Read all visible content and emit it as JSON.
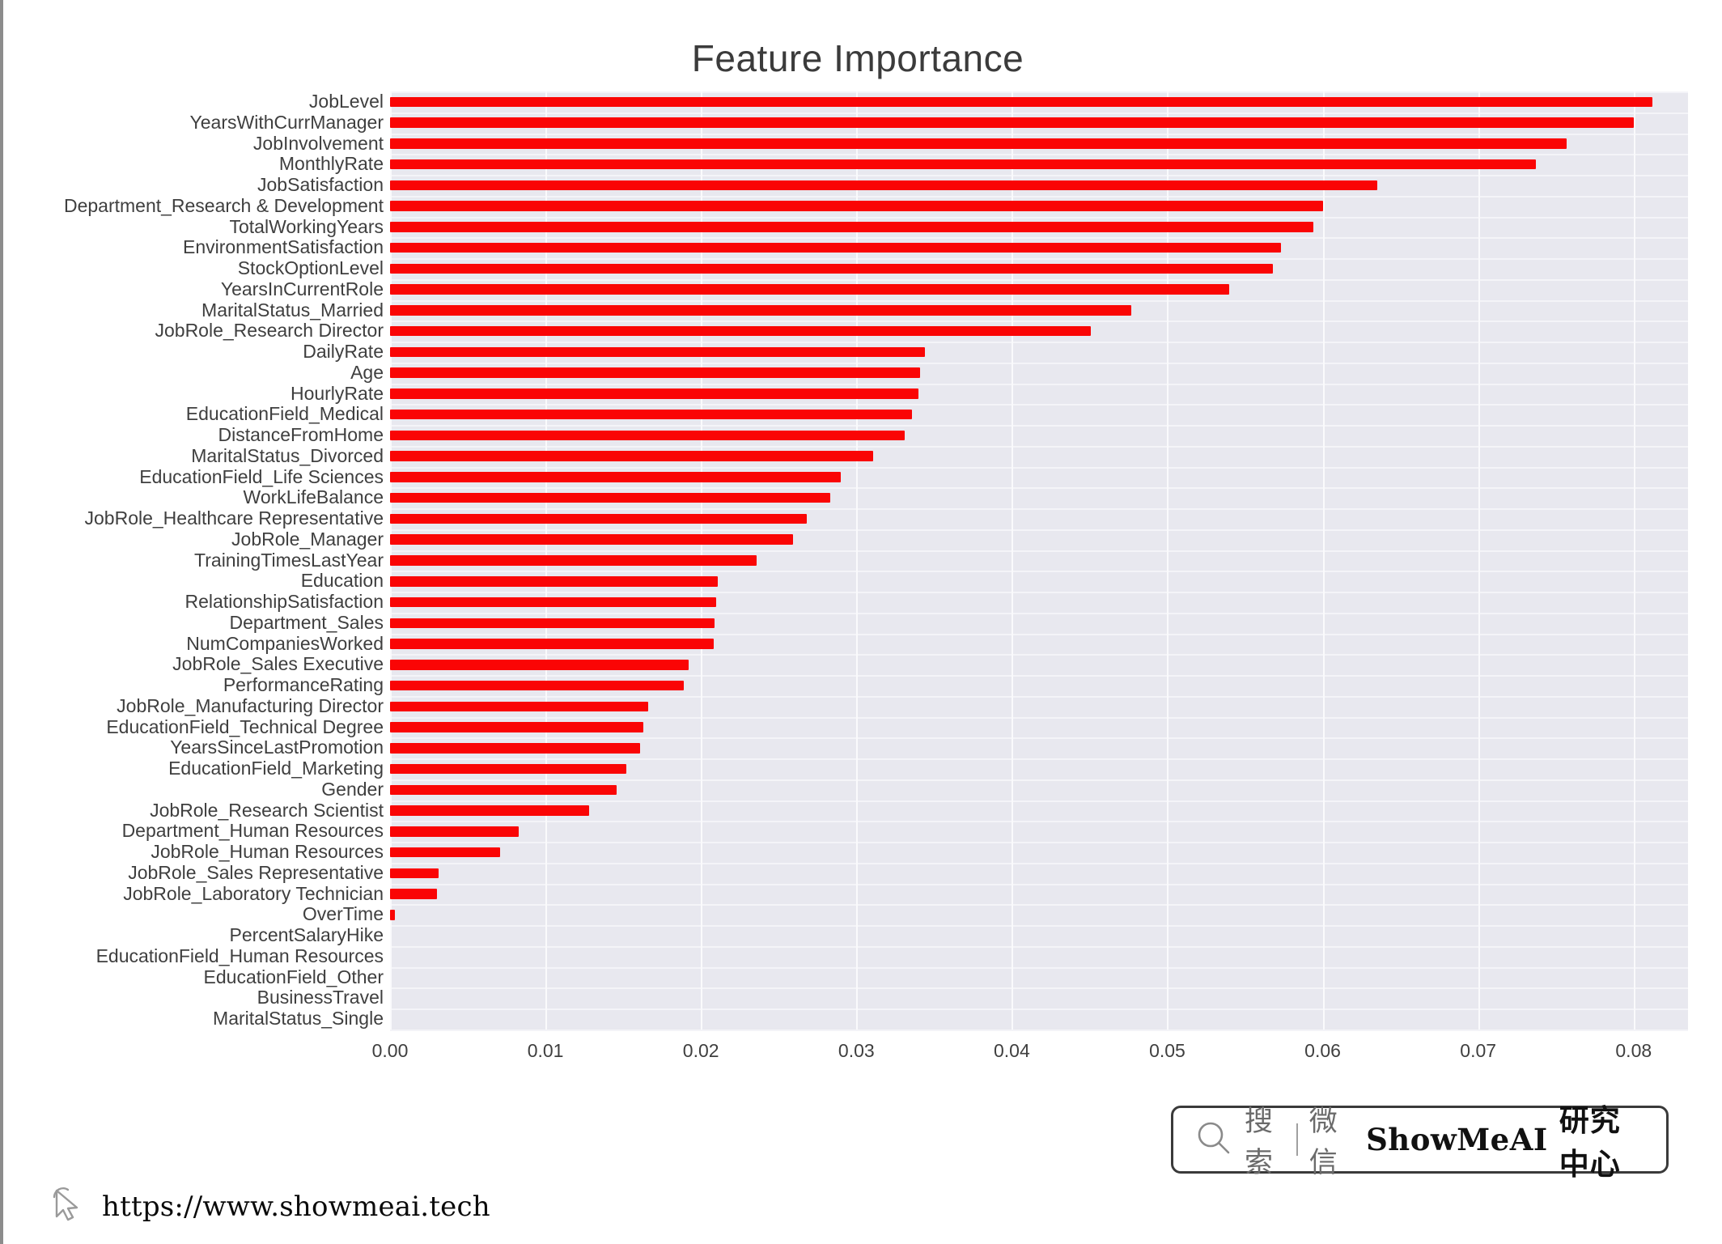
{
  "chart_data": {
    "type": "bar",
    "orientation": "horizontal",
    "title": "Feature Importance",
    "xlabel": "",
    "ylabel": "",
    "xlim": [
      0.0,
      0.0835
    ],
    "xticks": [
      "0.00",
      "0.01",
      "0.02",
      "0.03",
      "0.04",
      "0.05",
      "0.06",
      "0.07",
      "0.08"
    ],
    "xtick_values": [
      0.0,
      0.01,
      0.02,
      0.03,
      0.04,
      0.05,
      0.06,
      0.07,
      0.08
    ],
    "grid": "vertical-and-horizontal",
    "legend": "none",
    "bar_color": "#fa0505",
    "plot_background": "#e8e8ef",
    "categories": [
      "JobLevel",
      "YearsWithCurrManager",
      "JobInvolvement",
      "MonthlyRate",
      "JobSatisfaction",
      "Department_Research & Development",
      "TotalWorkingYears",
      "EnvironmentSatisfaction",
      "StockOptionLevel",
      "YearsInCurrentRole",
      "MaritalStatus_Married",
      "JobRole_Research Director",
      "DailyRate",
      "Age",
      "HourlyRate",
      "EducationField_Medical",
      "DistanceFromHome",
      "MaritalStatus_Divorced",
      "EducationField_Life Sciences",
      "WorkLifeBalance",
      "JobRole_Healthcare Representative",
      "JobRole_Manager",
      "TrainingTimesLastYear",
      "Education",
      "RelationshipSatisfaction",
      "Department_Sales",
      "NumCompaniesWorked",
      "JobRole_Sales Executive",
      "PerformanceRating",
      "JobRole_Manufacturing Director",
      "EducationField_Technical Degree",
      "YearsSinceLastPromotion",
      "EducationField_Marketing",
      "Gender",
      "JobRole_Research Scientist",
      "Department_Human Resources",
      "JobRole_Human Resources",
      "JobRole_Sales Representative",
      "JobRole_Laboratory Technician",
      "OverTime",
      "PercentSalaryHike",
      "EducationField_Human Resources",
      "EducationField_Other",
      "BusinessTravel",
      "MaritalStatus_Single"
    ],
    "values": [
      0.0812,
      0.08,
      0.0757,
      0.0737,
      0.0635,
      0.06,
      0.0594,
      0.0573,
      0.0568,
      0.054,
      0.0477,
      0.0451,
      0.0344,
      0.0341,
      0.034,
      0.0336,
      0.0331,
      0.0311,
      0.029,
      0.0283,
      0.0268,
      0.0259,
      0.0236,
      0.0211,
      0.021,
      0.0209,
      0.0208,
      0.0192,
      0.0189,
      0.0166,
      0.0163,
      0.0161,
      0.0152,
      0.0146,
      0.0128,
      0.0083,
      0.0071,
      0.0031,
      0.003,
      0.0003,
      0.0,
      0.0,
      0.0,
      0.0,
      0.0
    ]
  },
  "watermark": {
    "search_label": "搜索",
    "wechat_label": "微信",
    "brand_en": "ShowMeAI",
    "brand_cn": "研究中心",
    "search_icon": "search-icon"
  },
  "footer": {
    "url": "https://www.showmeai.tech",
    "cursor_icon": "cursor-arrow-icon"
  }
}
